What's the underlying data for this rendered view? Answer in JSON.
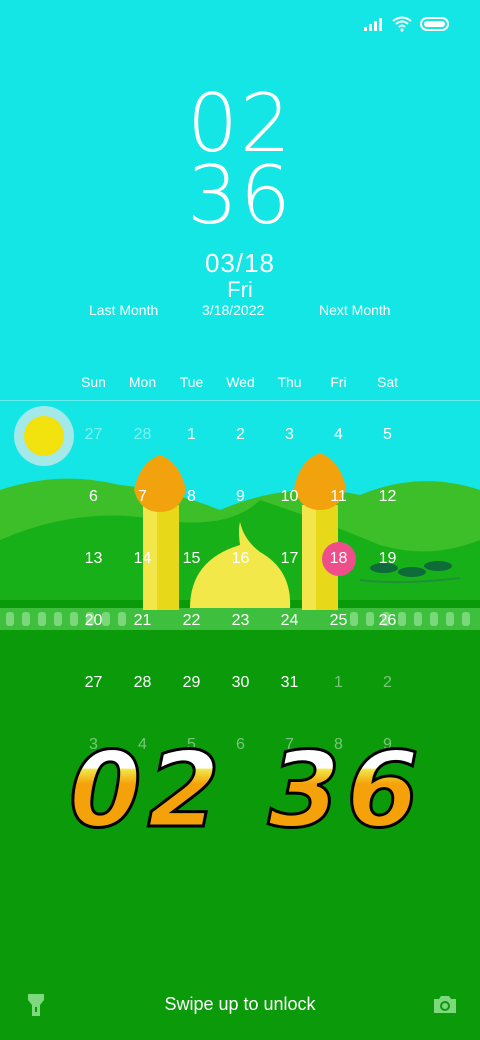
{
  "status": {
    "icons": [
      "signal-icon",
      "wifi-icon",
      "battery-icon"
    ]
  },
  "clock": {
    "hours": "02",
    "minutes": "36"
  },
  "date": {
    "short": "03/18",
    "weekday": "Fri",
    "full": "3/18/2022"
  },
  "nav": {
    "prev": "Last Month",
    "next": "Next Month"
  },
  "calendar": {
    "weekdays": [
      "Sun",
      "Mon",
      "Tue",
      "Wed",
      "Thu",
      "Fri",
      "Sat"
    ],
    "days": [
      {
        "d": "27",
        "dim": true
      },
      {
        "d": "28",
        "dim": true
      },
      {
        "d": "1"
      },
      {
        "d": "2"
      },
      {
        "d": "3"
      },
      {
        "d": "4"
      },
      {
        "d": "5"
      },
      {
        "d": "6"
      },
      {
        "d": "7"
      },
      {
        "d": "8"
      },
      {
        "d": "9"
      },
      {
        "d": "10"
      },
      {
        "d": "11"
      },
      {
        "d": "12"
      },
      {
        "d": "13"
      },
      {
        "d": "14"
      },
      {
        "d": "15"
      },
      {
        "d": "16"
      },
      {
        "d": "17"
      },
      {
        "d": "18",
        "today": true
      },
      {
        "d": "19"
      },
      {
        "d": "20"
      },
      {
        "d": "21"
      },
      {
        "d": "22"
      },
      {
        "d": "23"
      },
      {
        "d": "24"
      },
      {
        "d": "25"
      },
      {
        "d": "26"
      },
      {
        "d": "27"
      },
      {
        "d": "28"
      },
      {
        "d": "29"
      },
      {
        "d": "30"
      },
      {
        "d": "31"
      },
      {
        "d": "1",
        "dim": true
      },
      {
        "d": "2",
        "dim": true
      },
      {
        "d": "3",
        "dim": true
      },
      {
        "d": "4",
        "dim": true
      },
      {
        "d": "5",
        "dim": true
      },
      {
        "d": "6",
        "dim": true
      },
      {
        "d": "7",
        "dim": true
      },
      {
        "d": "8",
        "dim": true
      },
      {
        "d": "9",
        "dim": true
      }
    ]
  },
  "styled_clock": {
    "text": "02 36"
  },
  "bottom": {
    "unlock": "Swipe up to unlock",
    "left_icon": "flashlight-icon",
    "right_icon": "camera-icon"
  },
  "colors": {
    "sky": "#14e6e6",
    "grass": "#0a9a0a",
    "today": "#ee4f8a",
    "digit_orange": "#f5a20a"
  }
}
